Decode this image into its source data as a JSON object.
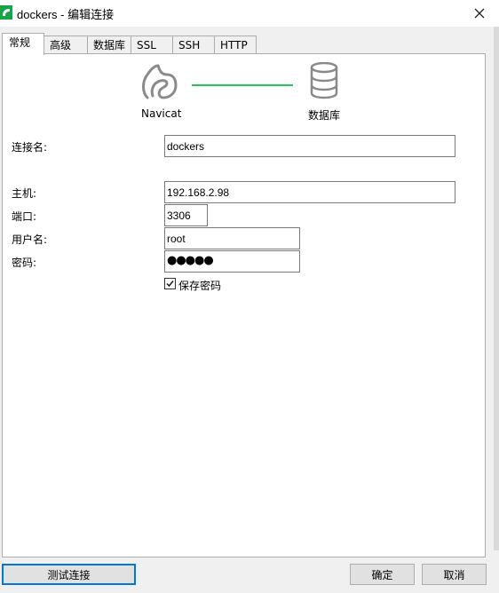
{
  "window": {
    "title": "dockers - 编辑连接"
  },
  "tabs": [
    "常规",
    "高级",
    "数据库",
    "SSL",
    "SSH",
    "HTTP"
  ],
  "diagram": {
    "left_label": "Navicat",
    "right_label": "数据库",
    "connector_color": "#22c55e"
  },
  "form": {
    "connection_name_label": "连接名:",
    "connection_name_value": "dockers",
    "host_label": "主机:",
    "host_value": "192.168.2.98",
    "port_label": "端口:",
    "port_value": "3306",
    "username_label": "用户名:",
    "username_value": "root",
    "password_label": "密码:",
    "password_mask": "●●●●●",
    "save_password_label": "保存密码",
    "save_password_checked": true
  },
  "footer": {
    "test_button": "测试连接",
    "ok_button": "确定",
    "cancel_button": "取消"
  }
}
